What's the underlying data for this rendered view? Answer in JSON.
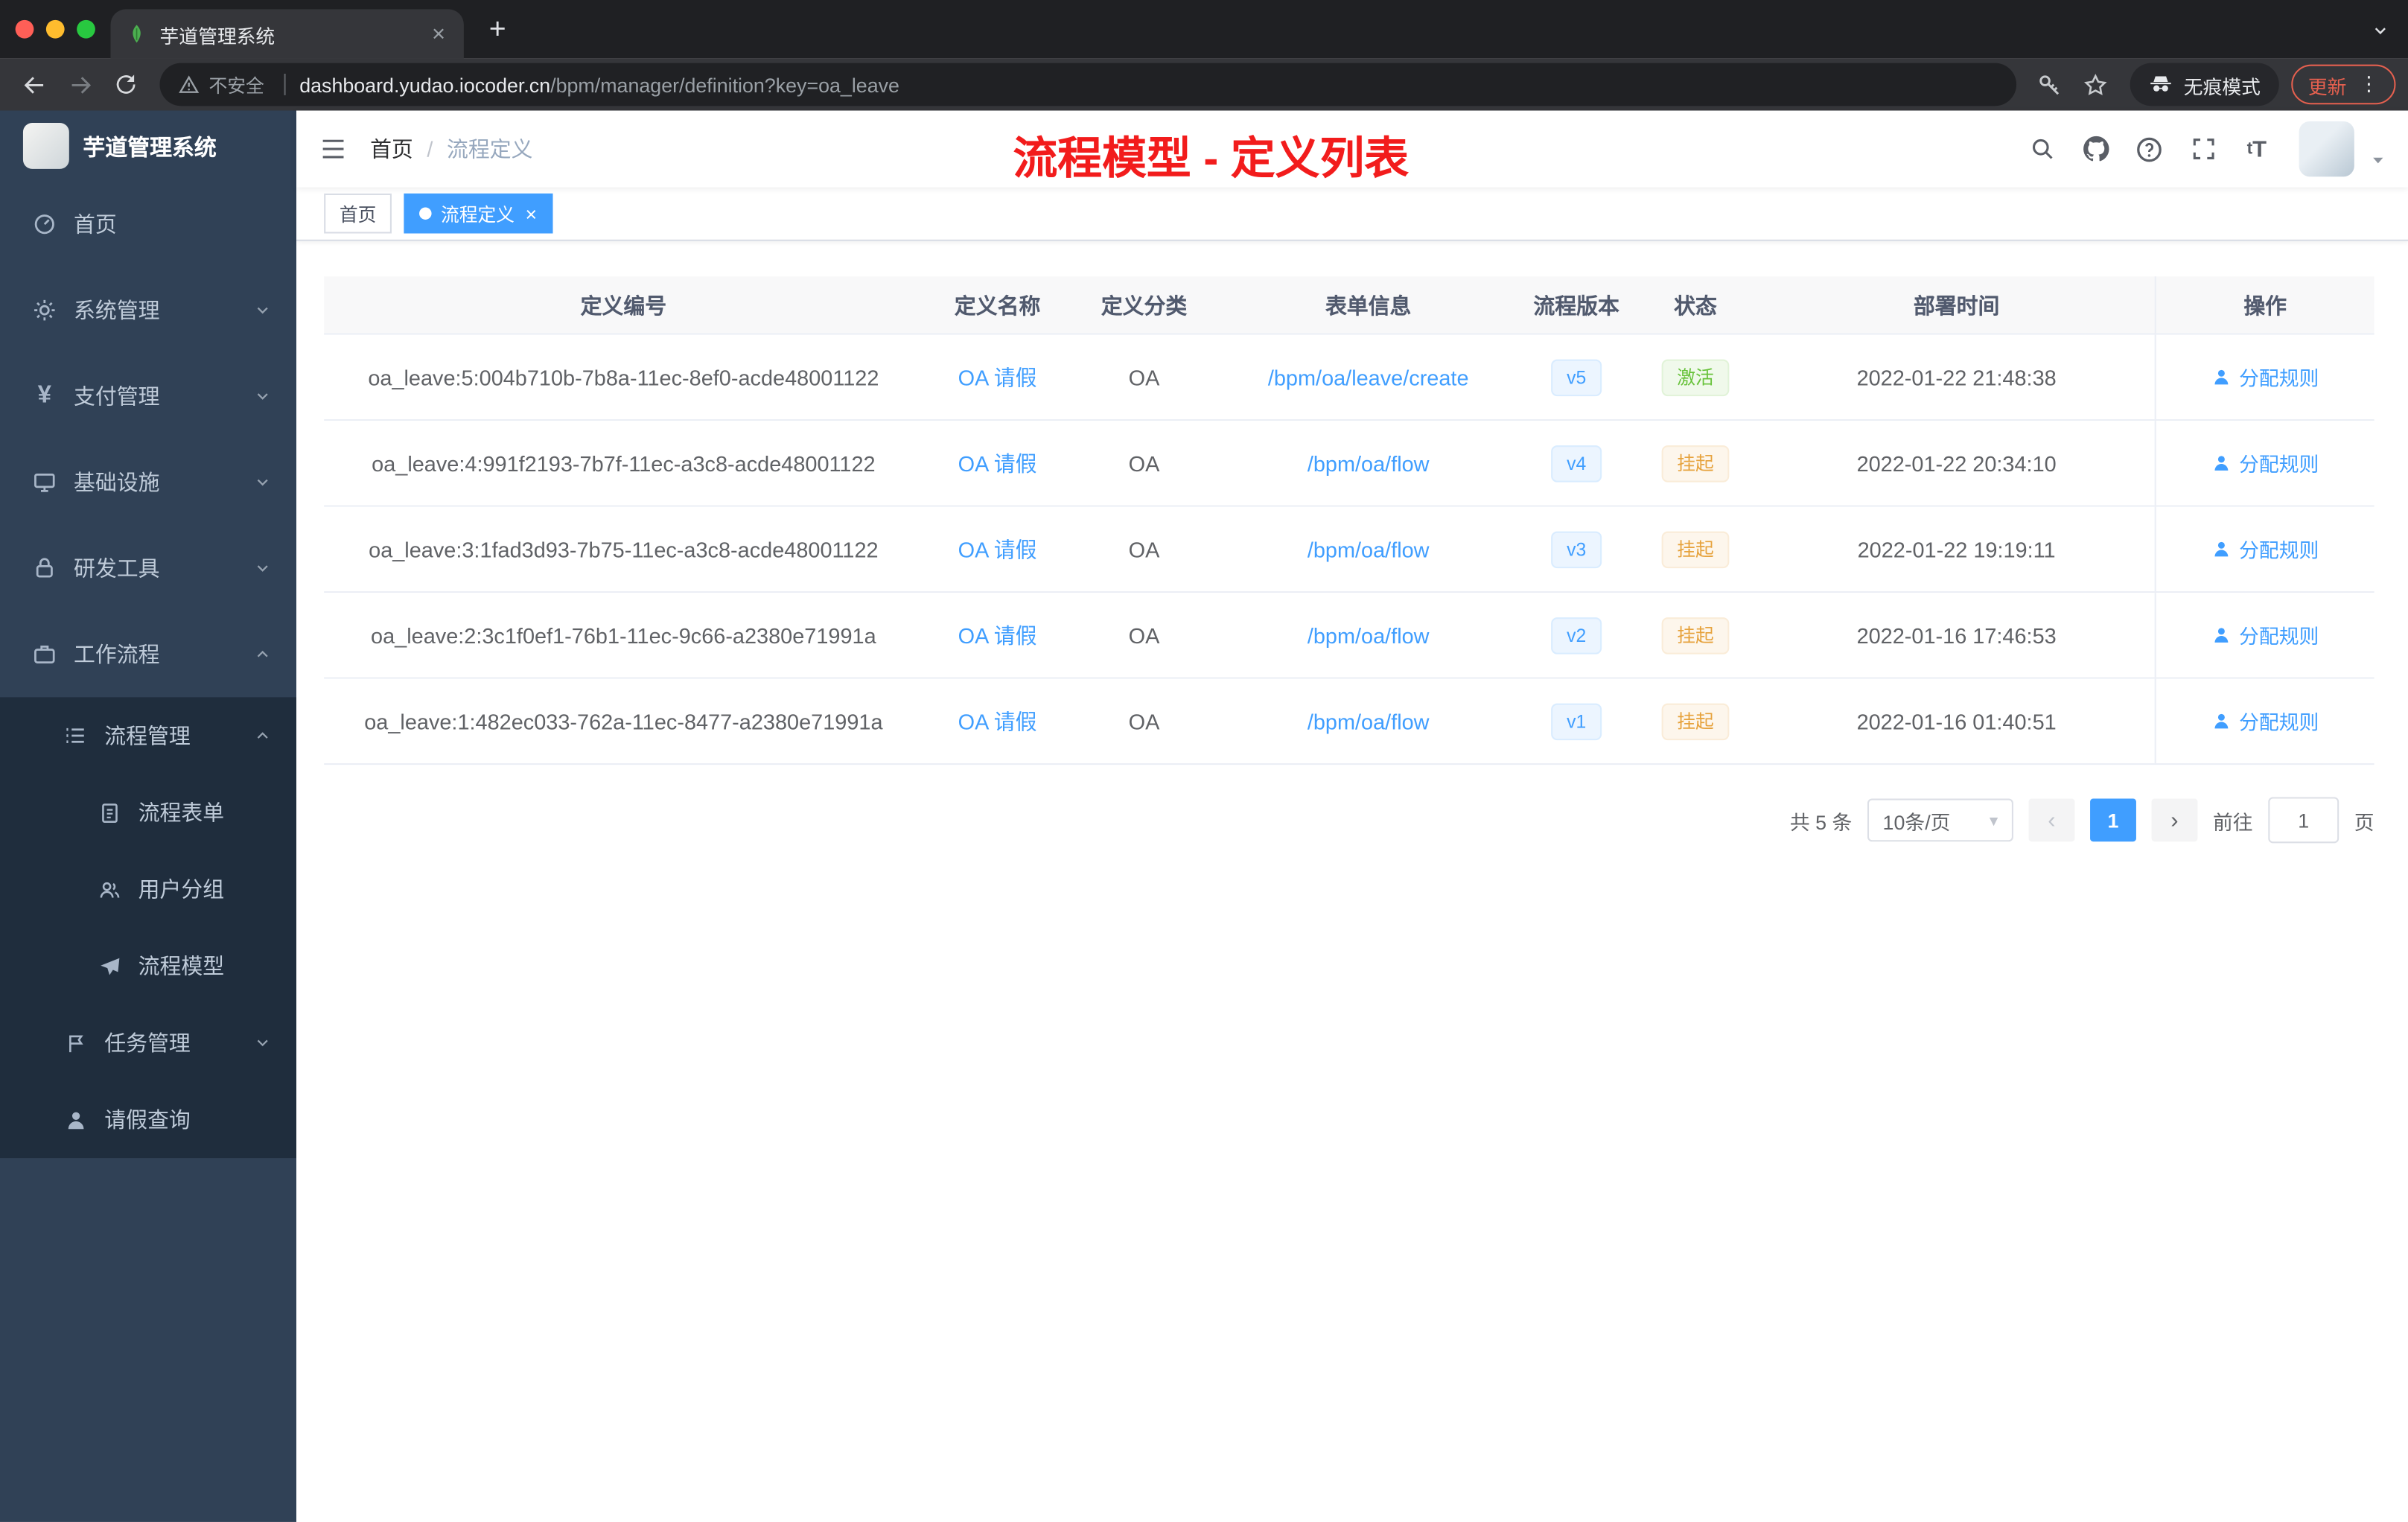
{
  "browser": {
    "tab_title": "芋道管理系统",
    "security_label": "不安全",
    "url_domain": "dashboard.yudao.iocoder.cn",
    "url_path": "/bpm/manager/definition?key=oa_leave",
    "incognito_label": "无痕模式",
    "update_label": "更新"
  },
  "sidebar": {
    "logo_title": "芋道管理系统",
    "home": "首页",
    "system": "系统管理",
    "payment": "支付管理",
    "infra": "基础设施",
    "devtools": "研发工具",
    "workflow": "工作流程",
    "process_mgmt": "流程管理",
    "process_form": "流程表单",
    "user_group": "用户分组",
    "process_model": "流程模型",
    "task_mgmt": "任务管理",
    "leave_query": "请假查询"
  },
  "header": {
    "breadcrumb_home": "首页",
    "breadcrumb_current": "流程定义",
    "annotation": "流程模型 - 定义列表"
  },
  "tags": {
    "home": "首页",
    "current": "流程定义"
  },
  "table": {
    "columns": [
      "定义编号",
      "定义名称",
      "定义分类",
      "表单信息",
      "流程版本",
      "状态",
      "部署时间",
      "操作"
    ],
    "rows": [
      {
        "id": "oa_leave:5:004b710b-7b8a-11ec-8ef0-acde48001122",
        "name": "OA 请假",
        "category": "OA",
        "form": "/bpm/oa/leave/create",
        "version": "v5",
        "status": "激活",
        "time": "2022-01-22 21:48:38",
        "action": "分配规则"
      },
      {
        "id": "oa_leave:4:991f2193-7b7f-11ec-a3c8-acde48001122",
        "name": "OA 请假",
        "category": "OA",
        "form": "/bpm/oa/flow",
        "version": "v4",
        "status": "挂起",
        "time": "2022-01-22 20:34:10",
        "action": "分配规则"
      },
      {
        "id": "oa_leave:3:1fad3d93-7b75-11ec-a3c8-acde48001122",
        "name": "OA 请假",
        "category": "OA",
        "form": "/bpm/oa/flow",
        "version": "v3",
        "status": "挂起",
        "time": "2022-01-22 19:19:11",
        "action": "分配规则"
      },
      {
        "id": "oa_leave:2:3c1f0ef1-76b1-11ec-9c66-a2380e71991a",
        "name": "OA 请假",
        "category": "OA",
        "form": "/bpm/oa/flow",
        "version": "v2",
        "status": "挂起",
        "time": "2022-01-16 17:46:53",
        "action": "分配规则"
      },
      {
        "id": "oa_leave:1:482ec033-762a-11ec-8477-a2380e71991a",
        "name": "OA 请假",
        "category": "OA",
        "form": "/bpm/oa/flow",
        "version": "v1",
        "status": "挂起",
        "time": "2022-01-16 01:40:51",
        "action": "分配规则"
      }
    ]
  },
  "pagination": {
    "total": "共 5 条",
    "page_size": "10条/页",
    "current_page": "1",
    "goto_label": "前往",
    "goto_value": "1",
    "goto_unit": "页"
  },
  "colors": {
    "accent": "#409eff",
    "success": "#67c23a",
    "warning": "#e6a23c",
    "annotation_red": "#f21c1c",
    "sidebar_bg": "#304156",
    "submenu_bg": "#1f2d3d"
  }
}
